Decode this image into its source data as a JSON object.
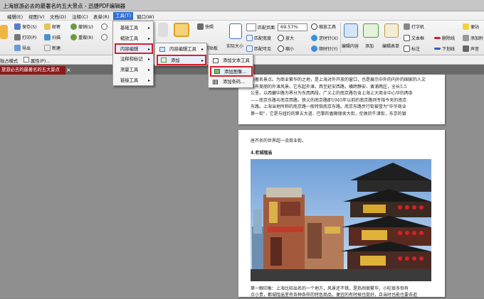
{
  "window": {
    "title": "上海旅游必去的最著名的五大景点 - 迅捷PDF编辑器"
  },
  "menubar": {
    "items": [
      {
        "label": "编辑(E)"
      },
      {
        "label": "视图(V)"
      },
      {
        "label": "文档(D)"
      },
      {
        "label": "注释(C)"
      },
      {
        "label": "表单(R)"
      },
      {
        "label": "工具(T)"
      },
      {
        "label": "窗口(W)"
      }
    ]
  },
  "ribbon": {
    "save": "保存(S)",
    "print": "打印(P)",
    "export": "导出",
    "mail": "邮寄",
    "scan": "扫描",
    "new": "新建",
    "undo": "撤销(U)",
    "redo": "重做(R)",
    "snapshot": "快照",
    "clipboard": "剪贴板",
    "actual_size": "实际大小",
    "fit_page": "匹配页面",
    "fit_width": "匹配宽度",
    "fit_visible": "匹配可见",
    "zoom_value": "69.57%",
    "zoom_tool": "缩放工具",
    "zoom_in": "放大",
    "zoom_out": "缩小",
    "rotate_ccw": "逆时针(X)",
    "rotate_cw": "顺时针(Y)",
    "edit_content": "编辑内容",
    "add": "添加",
    "edit_form": "编辑表单",
    "typewriter": "打字机",
    "textbox": "文本框",
    "callout": "标注",
    "strikeout": "删除线",
    "underline": "下划线",
    "sticky": "便站",
    "add_annot": "添加附",
    "sound": "声音"
  },
  "modebar": {
    "mode": "独占模式",
    "properties": "属性(P)..."
  },
  "tabs": {
    "doc": "旅游必去的最著名的五大景点",
    "close": "×"
  },
  "menus": {
    "tools": [
      "基础工具",
      "缩放工具",
      "内容编辑",
      "注释和标记",
      "测量工具",
      "链接工具"
    ],
    "content_edit": [
      "内容编辑工具",
      "添加"
    ],
    "add": [
      "添加文本工具",
      "添加图像...",
      "添加条码..."
    ]
  },
  "page1": {
    "lines": [
      "的著名景点。为商业繁华的之地，是上海对外开放的窗口，也是展示中外的内外的国家的人文",
      "具有美丽的外滩风景。它东起外滩，西至延安西路，横跨静安、黄浦两区，全长5.5",
      "公里，以西藏中路为界分为东西两段。广义上的南京路包含上海上大商业中心华的两条",
      "——南京东路与南京西路，狭义的南京路即1945年以前的南京路则专指今天的南京",
      "东路。上海当地所称的南京路一般特指南京东路。南京东路步行街被誉为\"中华商业",
      "第一街\"，它是与纽约的第五大道、巴黎的香榭丽舍大街，伦敦的牛津街，东京的银"
    ]
  },
  "page2": {
    "line1": "座齐名的世界超一流商业街。",
    "heading": "4.老城隍庙",
    "caption": "第一眼印象：上海比较出名的一个地方，风景还不错，是热闹很繁华，小吃很多但有",
    "caption2": "点小贵，都城隍庙里有各种各样的特色商品，便宜的有时候也挺好，且当时也能也要去逛"
  },
  "colors": {
    "accent": "#d8202b",
    "titlebar": "#c6c6c6",
    "tab": "#8b1b1b",
    "highlight": "#2f6fd1"
  }
}
